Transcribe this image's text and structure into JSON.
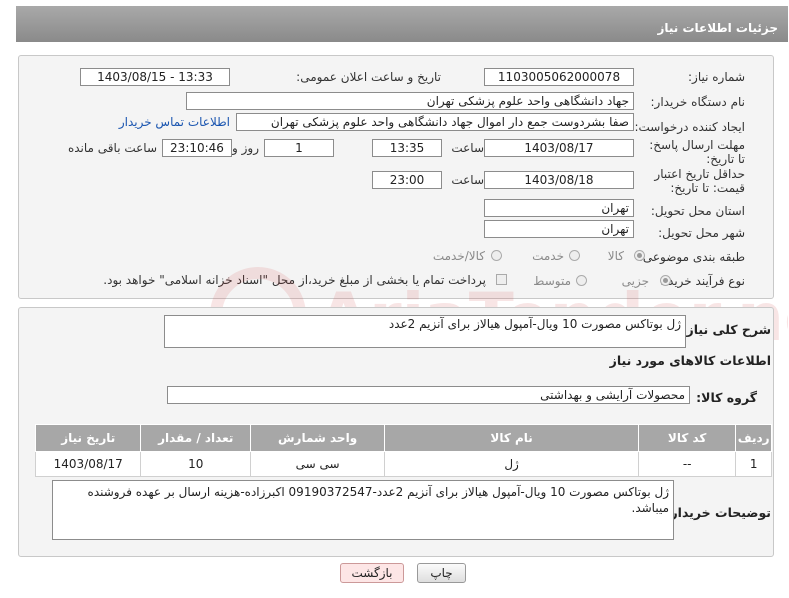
{
  "header": {
    "title": "جزئیات اطلاعات نیاز"
  },
  "form": {
    "need_number_label": "شماره نیاز:",
    "need_number": "1103005062000078",
    "announce_label": "تاریخ و ساعت اعلان عمومی:",
    "announce_value": "1403/08/15 - 13:33",
    "buyer_org_label": "نام دستگاه خریدار:",
    "buyer_org": "جهاد دانشگاهی واحد علوم پزشکی تهران",
    "requester_label": "ایجاد کننده درخواست:",
    "requester": "صفا بشردوست جمع دار اموال  جهاد دانشگاهی واحد علوم پزشکی تهران",
    "contact_link": "اطلاعات تماس خریدار",
    "deadline_label": "مهلت ارسال پاسخ: تا تاریخ:",
    "deadline_date": "1403/08/17",
    "time_label": "ساعت",
    "deadline_time": "13:35",
    "deadline_days": "1",
    "days_label": "روز و",
    "remaining_time": "23:10:46",
    "remaining_label": "ساعت باقی مانده",
    "validity_label": "حداقل تاریخ اعتبار قیمت: تا تاریخ:",
    "validity_date": "1403/08/18",
    "validity_time": "23:00",
    "province_label": "استان محل تحویل:",
    "province": "تهران",
    "city_label": "شهر محل تحویل:",
    "city": "تهران",
    "category_label": "طبقه بندی موضوعی:",
    "category_options": [
      "کالا",
      "خدمت",
      "کالا/خدمت"
    ],
    "category_selected": "کالا",
    "process_label": "نوع فرآیند خرید :",
    "process_options": [
      "جزیی",
      "متوسط"
    ],
    "process_selected": "جزیی",
    "payment_note": "پرداخت تمام یا بخشی از مبلغ خرید،از محل \"اسناد خزانه اسلامی\" خواهد بود."
  },
  "details": {
    "summary_label": "شرح کلی نیاز:",
    "summary": "ژل بوتاکس مصورت 10 ویال-آمپول هیالاز برای آنزیم 2عدد",
    "goods_info_title": "اطلاعات کالاهای مورد نیاز",
    "goods_group_label": "گروه کالا:",
    "goods_group": "محصولات آرایشی و بهداشتی",
    "table": {
      "headers": [
        "ردیف",
        "کد کالا",
        "نام کالا",
        "واحد شمارش",
        "تعداد / مقدار",
        "تاریخ نیاز"
      ],
      "rows": [
        [
          "1",
          "--",
          "ژل",
          "سی سی",
          "10",
          "1403/08/17"
        ]
      ]
    },
    "buyer_notes_label": "توضیحات خریدار:",
    "buyer_notes": "ژل بوتاکس مصورت 10 ویال-آمپول هیالاز برای آنزیم 2عدد-09190372547 اکبرزاده-هزینه ارسال بر عهده فروشنده میباشد."
  },
  "buttons": {
    "print": "چاپ",
    "back": "بازگشت"
  },
  "watermark": {
    "text": "AriaTender.net"
  },
  "colors": {
    "header_bg": "#999999",
    "link": "#1a55b0",
    "back_button_bg": "#fde6e6"
  }
}
